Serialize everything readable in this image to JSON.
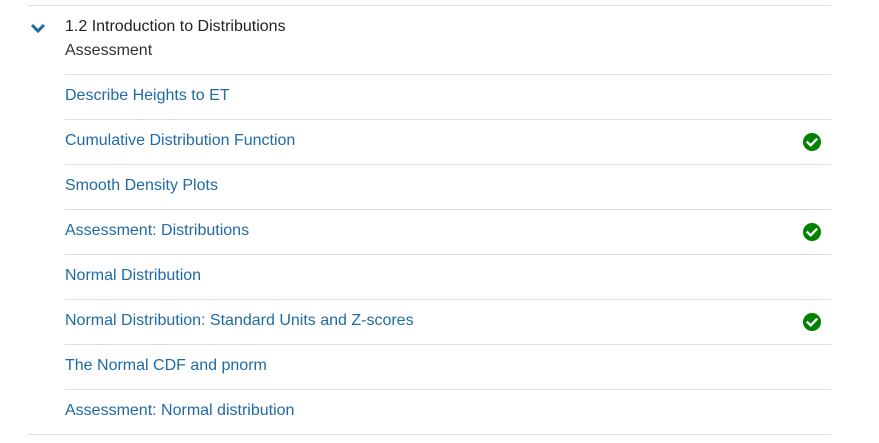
{
  "section": {
    "title": "1.2 Introduction to Distributions",
    "subtitle": "Assessment",
    "expand_icon": "chevron-down-icon"
  },
  "colors": {
    "link": "#1f6aa5",
    "chevron": "#1f6aa5",
    "completed": "#008100",
    "divider": "#dddddd"
  },
  "items": [
    {
      "label": "Describe Heights to ET",
      "completed": false
    },
    {
      "label": "Cumulative Distribution Function",
      "completed": true
    },
    {
      "label": "Smooth Density Plots",
      "completed": false
    },
    {
      "label": "Assessment: Distributions",
      "completed": true
    },
    {
      "label": "Normal Distribution",
      "completed": false
    },
    {
      "label": "Normal Distribution: Standard Units and Z-scores",
      "completed": true
    },
    {
      "label": "The Normal CDF and pnorm",
      "completed": false
    },
    {
      "label": "Assessment: Normal distribution",
      "completed": false
    }
  ]
}
